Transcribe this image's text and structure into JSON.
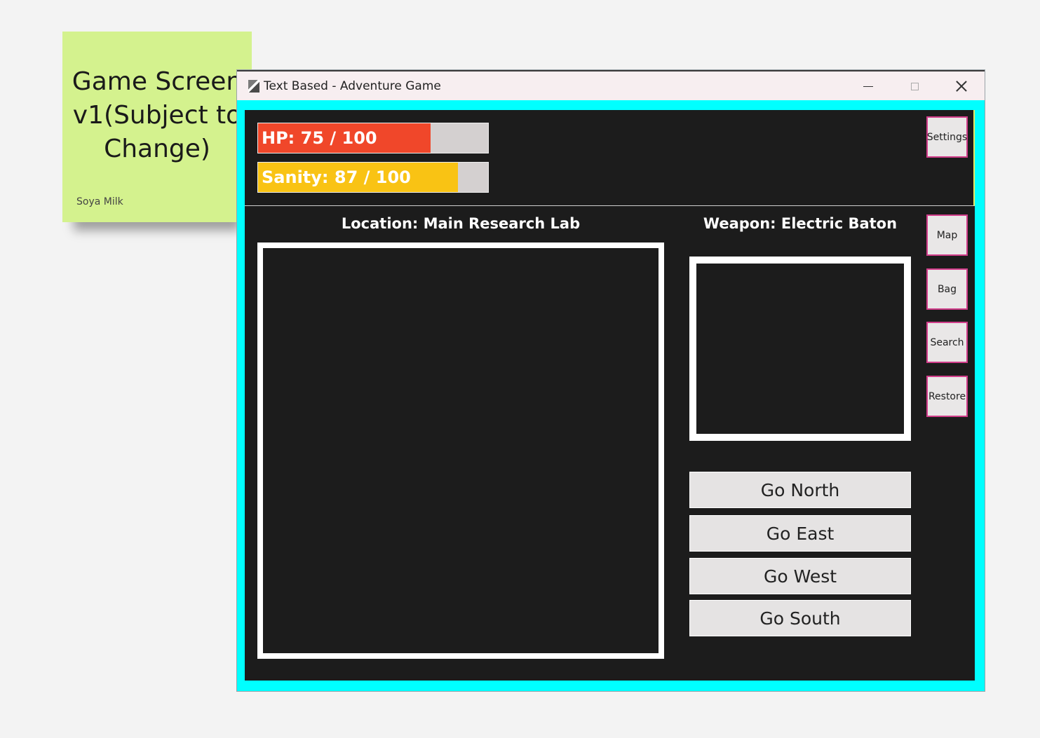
{
  "sticky_note": {
    "text": "Game Screen v1(Subject to Change)",
    "author": "Soya Milk",
    "color": "#d4f28e"
  },
  "window": {
    "title": "Text Based - Adventure Game",
    "controls": {
      "minimize": "minimize-icon",
      "maximize": "maximize-icon",
      "close": "close-icon"
    },
    "border_color": "#00ffff",
    "background_color": "#1c1c1c"
  },
  "stats": {
    "hp": {
      "label": "HP: 75 / 100",
      "value": 75,
      "max": 100,
      "color": "#f0472a"
    },
    "sanity": {
      "label": "Sanity: 87 / 100",
      "value": 87,
      "max": 100,
      "color": "#f9c314"
    }
  },
  "side_buttons": [
    "Settings",
    "Map",
    "Bag",
    "Search",
    "Restore"
  ],
  "location": {
    "label": "Location: Main Research Lab"
  },
  "weapon": {
    "label": "Weapon: Electric Baton"
  },
  "movement": [
    "Go North",
    "Go East",
    "Go West",
    "Go South"
  ]
}
